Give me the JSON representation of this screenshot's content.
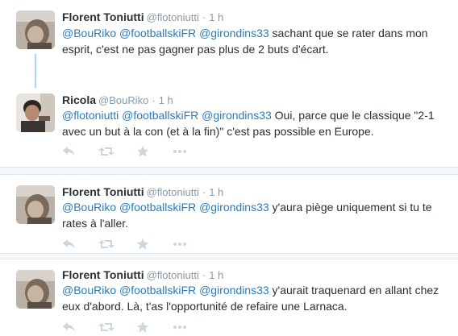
{
  "tweets": [
    {
      "fullname": "Florent Toniutti",
      "username": "@flotoniutti",
      "separator": "·",
      "time": "1 h",
      "line1": [
        {
          "t": "@BouRiko",
          "mention": true
        },
        {
          "t": " ",
          "mention": false
        },
        {
          "t": "@footballskiFR",
          "mention": true
        },
        {
          "t": " ",
          "mention": false
        },
        {
          "t": "@girondins33",
          "mention": true
        },
        {
          "t": " sachant que se rater dans mon",
          "mention": false
        }
      ],
      "line2": "esprit, c'est ne pas gagner pas plus de 2 buts d'écart."
    },
    {
      "fullname": "Ricola",
      "username": "@BouRiko",
      "separator": "·",
      "time": "1 h",
      "line1": [
        {
          "t": "@flotoniutti",
          "mention": true
        },
        {
          "t": " ",
          "mention": false
        },
        {
          "t": "@footballskiFR",
          "mention": true
        },
        {
          "t": " ",
          "mention": false
        },
        {
          "t": "@girondins33",
          "mention": true
        },
        {
          "t": " Oui, parce que le classique \"2-1",
          "mention": false
        }
      ],
      "line2": "avec un but à la con (et à la fin)\" c'est pas possible en Europe."
    },
    {
      "fullname": "Florent Toniutti",
      "username": "@flotoniutti",
      "separator": "·",
      "time": "1 h",
      "line1": [
        {
          "t": "@BouRiko",
          "mention": true
        },
        {
          "t": " ",
          "mention": false
        },
        {
          "t": "@footballskiFR",
          "mention": true
        },
        {
          "t": " ",
          "mention": false
        },
        {
          "t": "@girondins33",
          "mention": true
        },
        {
          "t": " y'aura piège uniquement si tu te",
          "mention": false
        }
      ],
      "line2": "rates à l'aller."
    },
    {
      "fullname": "Florent Toniutti",
      "username": "@flotoniutti",
      "separator": "·",
      "time": "1 h",
      "line1": [
        {
          "t": "@BouRiko",
          "mention": true
        },
        {
          "t": " ",
          "mention": false
        },
        {
          "t": "@footballskiFR",
          "mention": true
        },
        {
          "t": " ",
          "mention": false
        },
        {
          "t": "@girondins33",
          "mention": true
        },
        {
          "t": " y'aurait traquenard en allant chez",
          "mention": false
        }
      ],
      "line2": "eux d'abord. Là, t'as l'opportunité de refaire une Larnaca."
    }
  ],
  "icons": {
    "reply": "reply-icon",
    "retweet": "retweet-icon",
    "favorite": "star-icon",
    "more": "more-dots-icon"
  },
  "colors": {
    "mention": "#2b7bb9",
    "secondary": "#8899a6",
    "action_icon": "#ccd6dd",
    "thread_line": "#a8d4f2",
    "divider": "#f5f8fa"
  }
}
